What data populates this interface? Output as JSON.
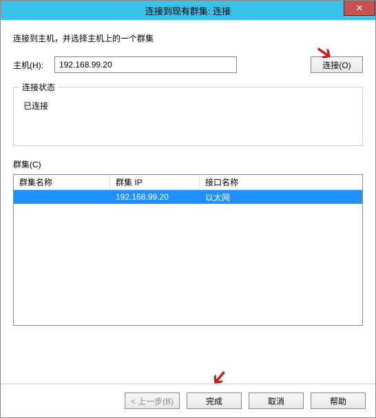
{
  "titlebar": {
    "title": "连接到现有群集: 连接"
  },
  "instruction": "连接到主机，并选择主机上的一个群集",
  "host": {
    "label": "主机(H):",
    "value": "192.168.99.20"
  },
  "connect_button": "连接(O)",
  "status": {
    "legend": "连接状态",
    "value": "已连接"
  },
  "cluster_label": "群集(C)",
  "table": {
    "headers": {
      "name": "群集名称",
      "ip": "群集 IP",
      "interface": "接口名称"
    },
    "rows": [
      {
        "name": "",
        "ip": "192.168.99.20",
        "interface": "以太网"
      }
    ]
  },
  "footer": {
    "back": "< 上一步(B)",
    "finish": "完成",
    "cancel": "取消",
    "help": "帮助"
  }
}
